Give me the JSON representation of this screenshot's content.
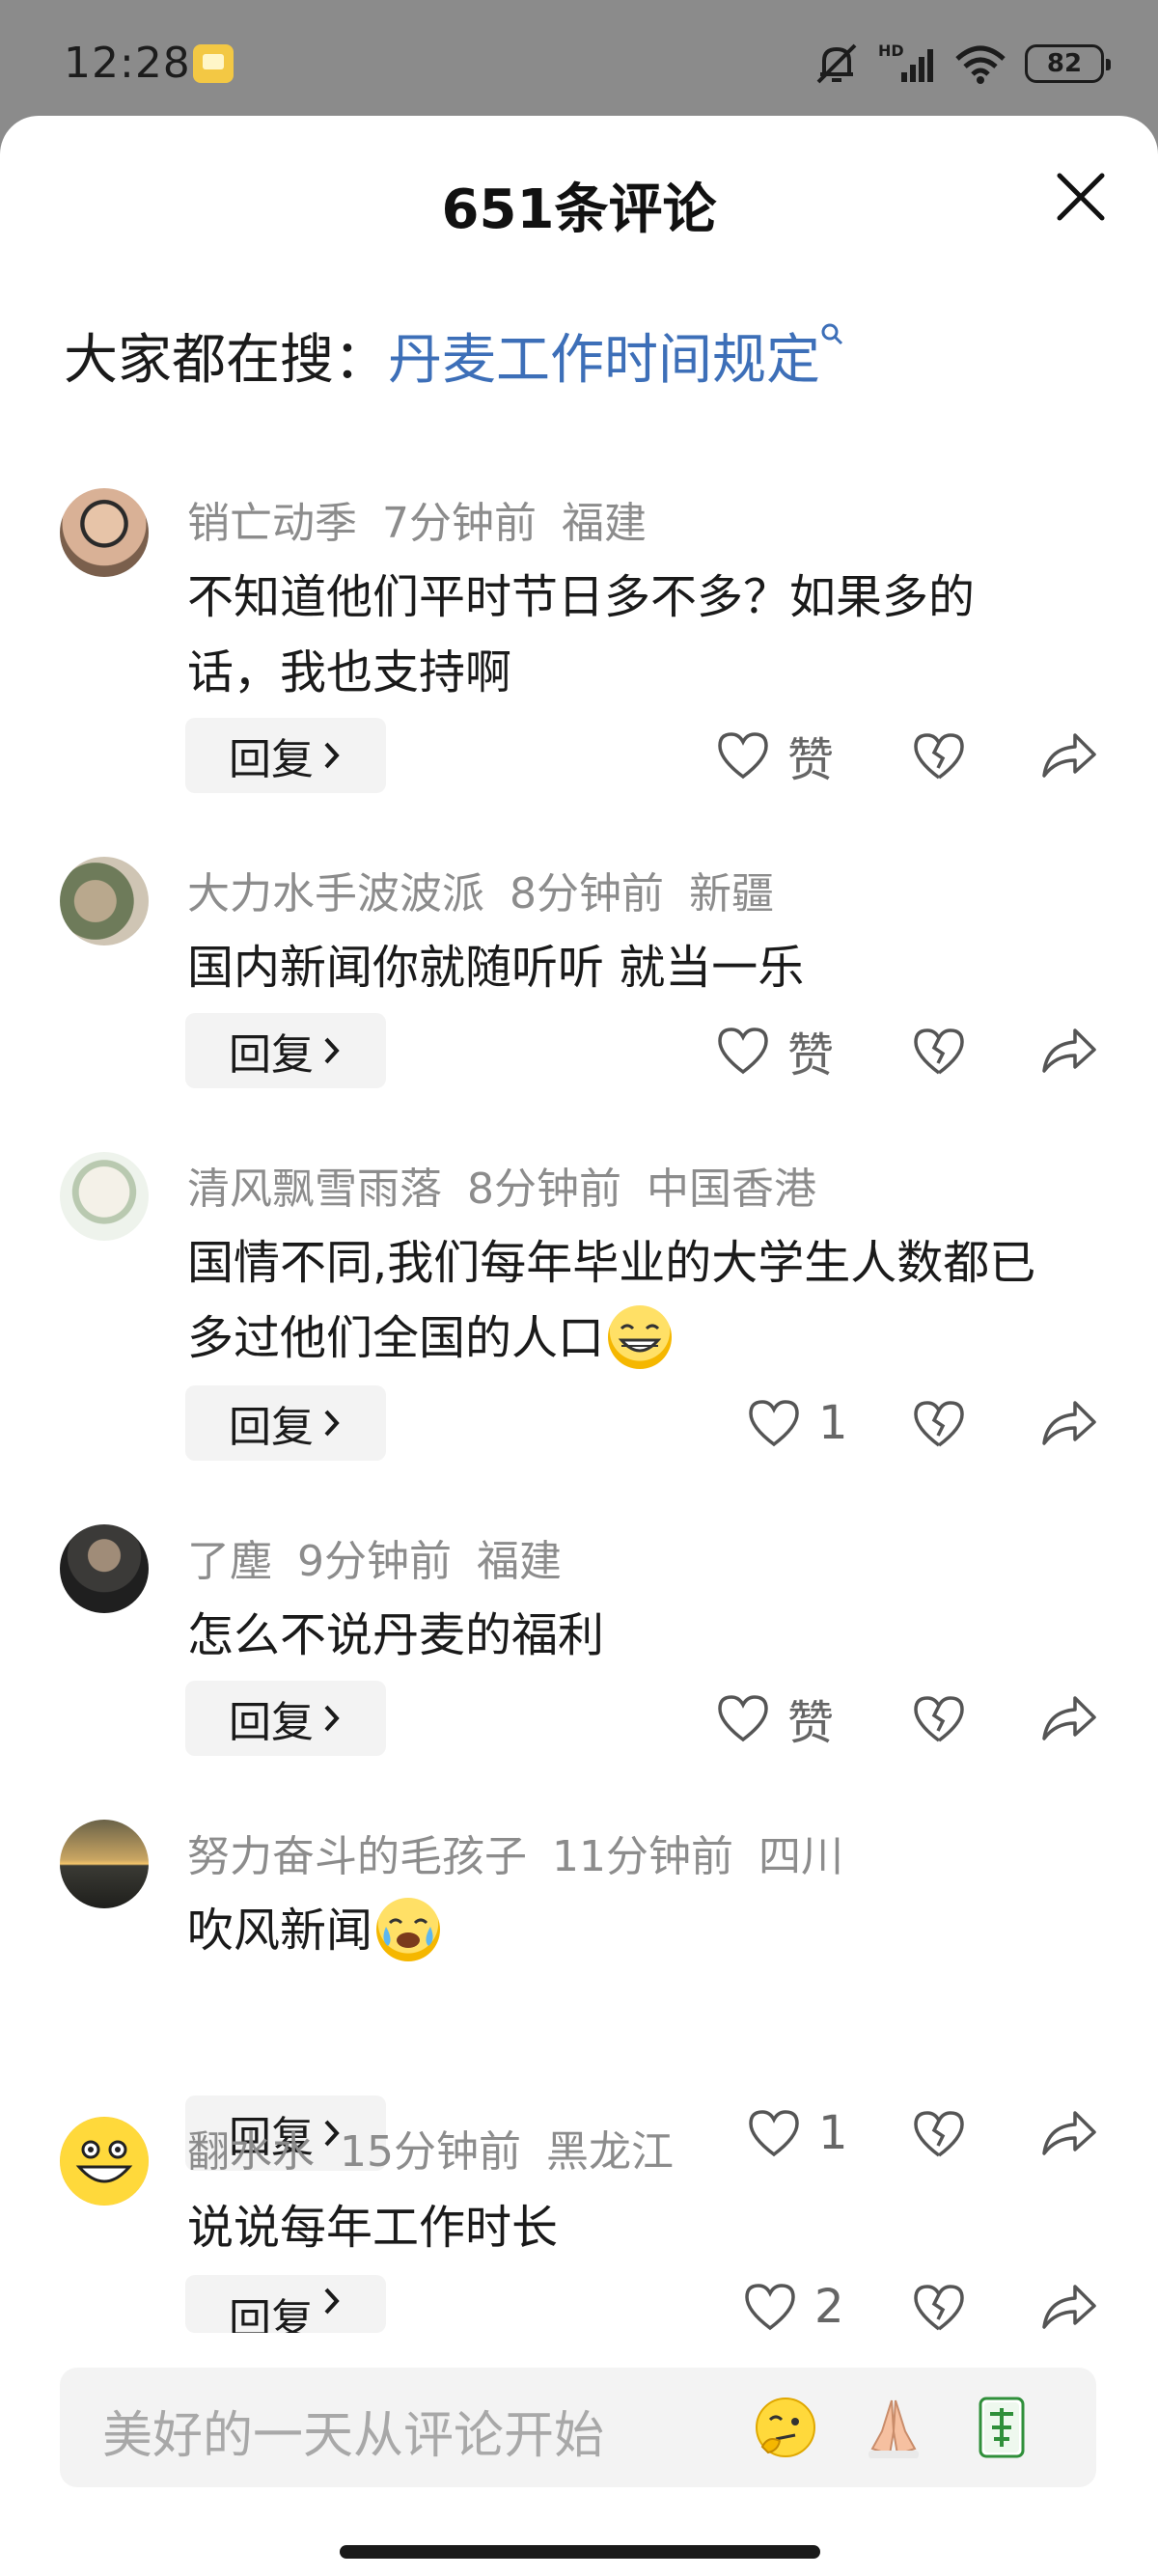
{
  "status_bar": {
    "time": "12:28",
    "battery": "82",
    "network_label": "HD"
  },
  "header": {
    "title": "651条评论"
  },
  "search_hint": {
    "prefix": "大家都在搜：",
    "query": "丹麦工作时间规定"
  },
  "reply_label": "回复",
  "comments": [
    {
      "user": "销亡动季",
      "time": "7分钟前",
      "location": "福建",
      "text": "不知道他们平时节日多不多？如果多的话，我也支持啊",
      "likes": "赞"
    },
    {
      "user": "大力水手波波派",
      "time": "8分钟前",
      "location": "新疆",
      "text": "国内新闻你就随听听 就当一乐",
      "likes": "赞"
    },
    {
      "user": "清风飘雪雨落",
      "time": "8分钟前",
      "location": "中国香港",
      "text": "国情不同,我们每年毕业的大学生人数都已多过他们全国的人口",
      "likes": "1"
    },
    {
      "user": "了塵",
      "time": "9分钟前",
      "location": "福建",
      "text": "怎么不说丹麦的福利",
      "likes": "赞"
    },
    {
      "user": "努力奋斗的毛孩子",
      "time": "11分钟前",
      "location": "四川",
      "text": "吹风新闻",
      "likes": "1"
    },
    {
      "user": "翻水水",
      "time": "15分钟前",
      "location": "黑龙江",
      "text": "说说每年工作时长",
      "likes": "2"
    }
  ],
  "input": {
    "placeholder": "美好的一天从评论开始"
  },
  "colors": {
    "link": "#3d6fb8",
    "meta_gray": "#8c8c8c",
    "status_bar_bg": "#8b8b8b"
  }
}
